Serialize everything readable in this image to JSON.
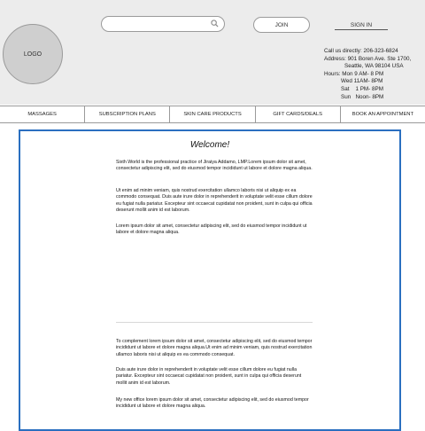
{
  "header": {
    "logo_text": "LOGO",
    "search_placeholder": "",
    "join_label": "JOIN",
    "signin_label": "SIGN IN",
    "contact": {
      "phone": "Call us directly: 206-323-6824",
      "address_line1": "Address: 901 Boren Ave. Ste 1700,",
      "address_line2": "Seattle, WA 98104 USA",
      "hours": [
        "Hours: Mon 9 AM- 8 PM",
        "Wed 11AM- 8PM",
        "Sat    1 PM- 8PM",
        "Sun   Noon- 8PM"
      ]
    }
  },
  "nav": {
    "items": [
      "MASSAGES",
      "SUBSCRIPTION PLANS",
      "SKIN CARE PRODUCTS",
      "GIFT CARDS/DEALS",
      "BOOK AN APPOINTMENT"
    ]
  },
  "main": {
    "title": "Welcome!",
    "paragraphs": [
      "Sixth World is the professional practice of Jiraiya Addamo, LMP.Lorem ipsum dolor sit amet, consectetur adipiscing elit, sed do eiusmod tempor incididunt ut labore et dolore magna aliqua.",
      "Ut enim ad minim veniam, quis nostrud exercitation ullamco laboris nisi ut aliquip ex ea commodo consequat. Duis aute irure dolor in reprehenderit in voluptate velit esse cillum dolore eu fugiat nulla pariatur. Excepteur sint occaecat cupidatat non proident, sunt in culpa qui officia deserunt mollit anim id est laborum.",
      "Lorem ipsum dolor sit amet, consectetur adipiscing elit, sed do eiusmod tempor incididunt ut labore et dolore magna aliqua.",
      "To complement lorem ipsum dolor sit amet, consectetur adipiscing elit, sed do eiusmod tempor incididunt ut labore et dolore magna aliqua.Ut enim ad minim veniam, quis nostrud exercitation ullamco laboris nisi ut aliquip ex ea commodo consequat.",
      "Duis aute irure dolor in reprehenderit in voluptate velit esse cillum dolore eu fugiat nulla pariatur. Excepteur sint occaecat cupidatat non proident, sunt in culpa qui officia deserunt mollit anim id est laborum.",
      "My new office lorem ipsum dolor sit amet, consectetur adipiscing elit, sed do eiusmod tempor incididunt ut labore et dolore magna aliqua."
    ]
  }
}
